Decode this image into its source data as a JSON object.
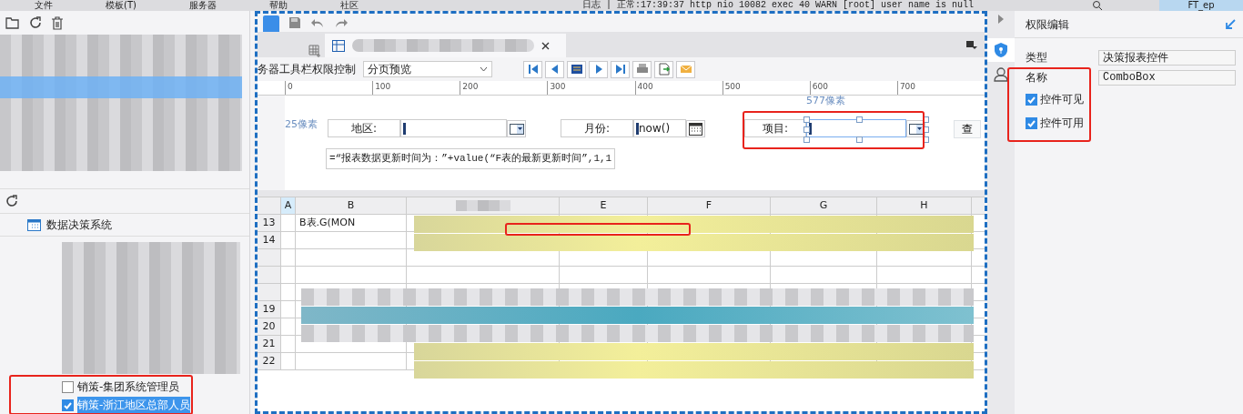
{
  "menubar": {
    "items": [
      "文件",
      "模板(T)",
      "服务器",
      "帮助",
      "社区"
    ],
    "log": "日志 | 正常:17:39:37 http nio 10082 exec 40 WARN [root] user name is null",
    "user": "FT_ep"
  },
  "left_panel": {
    "root": "数据决策系统",
    "roles": [
      {
        "label": "销策-集团系统管理员",
        "checked": false,
        "selected": false
      },
      {
        "label": "销策-浙江地区总部人员",
        "checked": true,
        "selected": true
      }
    ]
  },
  "designer": {
    "preview_label": "务器工具栏权限控制",
    "preview_mode": "分页预览",
    "ruler": [
      "0",
      "100",
      "200",
      "300",
      "400",
      "500",
      "600",
      "700"
    ],
    "canvas": {
      "height_label": "25像素",
      "width_label": "577像素",
      "query_button": "查",
      "formula": "=“报表数据更新时间为：”+value(“F表的最新更新时间”,1,1",
      "widgets": [
        {
          "kind": "combo",
          "label": "地区:",
          "selected": false
        },
        {
          "kind": "date",
          "label": "月份:",
          "value": "now()",
          "selected": false
        },
        {
          "kind": "combo",
          "label": "项目:",
          "selected": true
        }
      ]
    },
    "grid": {
      "columns": [
        "A",
        "B",
        "",
        "E",
        "F",
        "G",
        "H"
      ],
      "rows": [
        {
          "number": "13",
          "kind": "yellow",
          "cell": "B表.G(MON"
        },
        {
          "number": "14",
          "kind": "yellow"
        },
        {
          "kind": "plain"
        },
        {
          "kind": "plain"
        },
        {
          "kind": "gray"
        },
        {
          "number": "19",
          "kind": "teal"
        },
        {
          "number": "20",
          "kind": "gray"
        },
        {
          "number": "21",
          "kind": "yellow"
        },
        {
          "number": "22",
          "kind": "yellow"
        }
      ]
    }
  },
  "permission_panel": {
    "title": "权限编辑",
    "fields": [
      {
        "label": "类型",
        "value": "决策报表控件"
      },
      {
        "label": "名称",
        "value": "ComboBox"
      }
    ],
    "options": [
      {
        "label": "控件可见",
        "checked": true
      },
      {
        "label": "控件可用",
        "checked": true
      }
    ]
  }
}
